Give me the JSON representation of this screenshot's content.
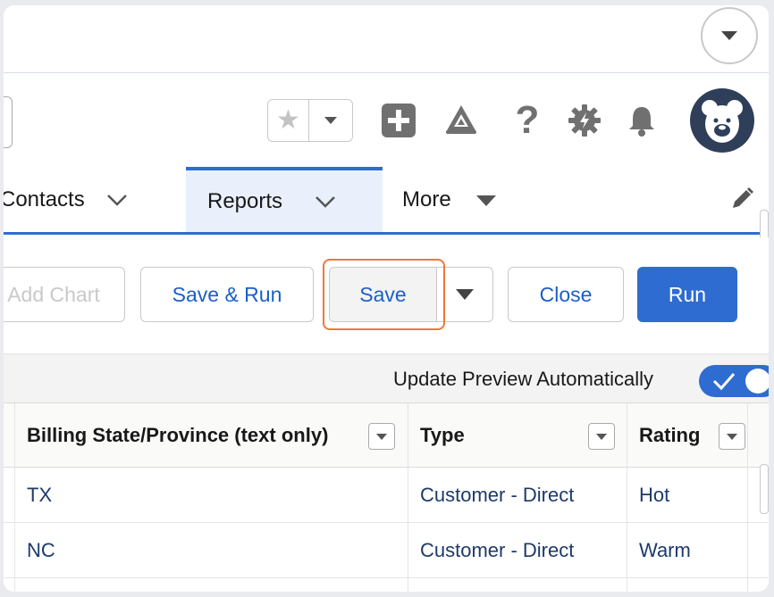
{
  "header": {
    "favorite_icon": "star-icon",
    "icons": [
      "add-icon",
      "trailhead-icon",
      "help-icon",
      "setup-gear-icon",
      "notifications-bell-icon"
    ],
    "avatar_icon": "bear-avatar-icon",
    "help_glyph": "?"
  },
  "nav": {
    "tabs": [
      {
        "label": "Contacts"
      },
      {
        "label": "Reports"
      },
      {
        "label": "More"
      }
    ]
  },
  "toolbar": {
    "add_chart": "Add Chart",
    "save_and_run": "Save & Run",
    "save": "Save",
    "close": "Close",
    "run": "Run"
  },
  "preview": {
    "label": "Update Preview Automatically",
    "enabled": true
  },
  "table": {
    "columns": [
      "Billing State/Province (text only)",
      "Type",
      "Rating"
    ],
    "rows": [
      [
        "TX",
        "Customer - Direct",
        "Hot"
      ],
      [
        "NC",
        "Customer - Direct",
        "Warm"
      ]
    ]
  },
  "colors": {
    "brand_blue": "#2f6cd1",
    "link_blue": "#1b5fc7",
    "highlight_orange": "#f0773d"
  }
}
